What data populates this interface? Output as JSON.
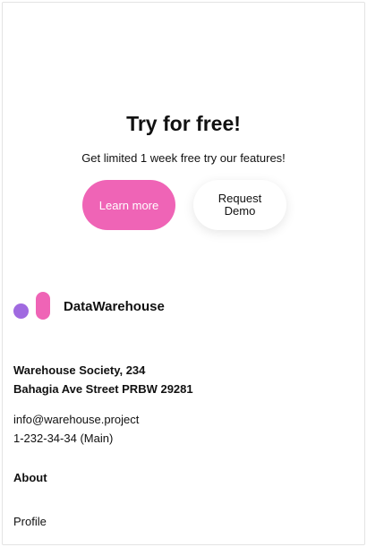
{
  "cta": {
    "title": "Try for free!",
    "subtitle": "Get limited 1 week free try our features!",
    "learn_more_label": "Learn more",
    "request_demo_label": "Request Demo"
  },
  "brand": {
    "name": "DataWarehouse",
    "logo_colors": {
      "dot": "#a06ae0",
      "pill": "#ef64b6"
    }
  },
  "footer": {
    "address_line1": "Warehouse Society, 234",
    "address_line2": "Bahagia Ave Street PRBW 29281",
    "email": "info@warehouse.project",
    "phone": "1-232-34-34 (Main)",
    "about_heading": "About",
    "profile_link": "Profile"
  },
  "colors": {
    "accent": "#ef64b6",
    "secondary_accent": "#a06ae0"
  }
}
